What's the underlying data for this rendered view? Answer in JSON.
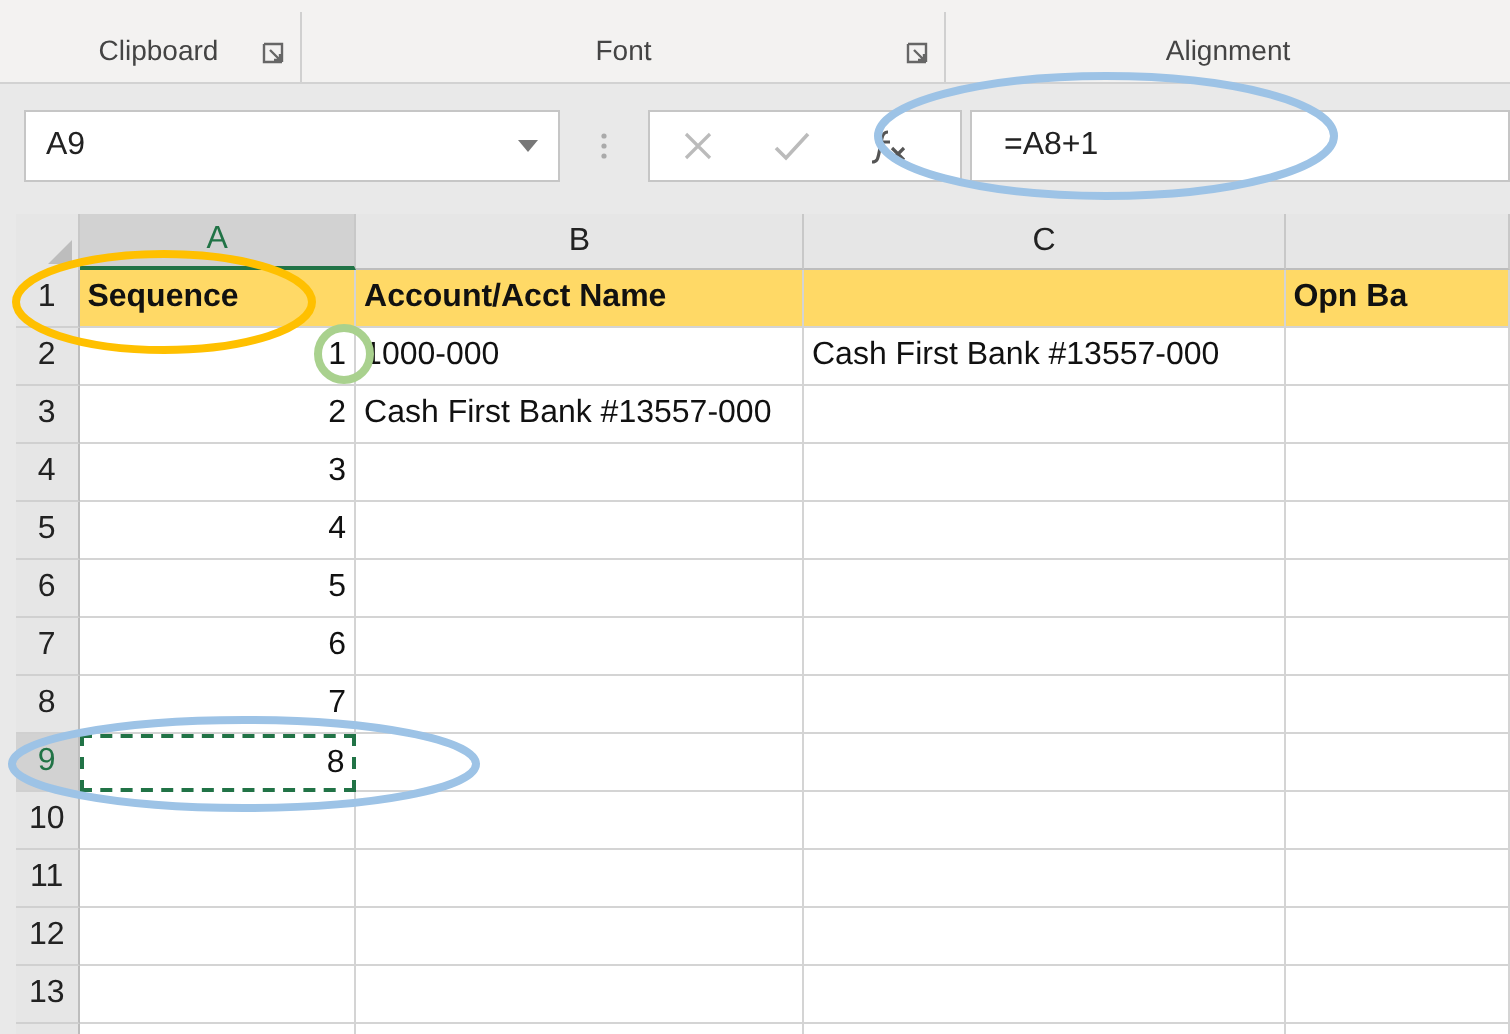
{
  "ribbon_groups": [
    {
      "label": "Clipboard",
      "launcher": true
    },
    {
      "label": "Font",
      "launcher": true
    },
    {
      "label": "Alignment",
      "launcher": false
    }
  ],
  "name_box": "A9",
  "formula": "=A8+1",
  "columns": [
    {
      "label": "A",
      "selected": true
    },
    {
      "label": "B",
      "selected": false
    },
    {
      "label": "C",
      "selected": false
    },
    {
      "selected": false
    }
  ],
  "rows": [
    {
      "num": "1",
      "kind": "header",
      "selected": false,
      "cells": {
        "A": "Sequence",
        "B": "Account/Acct Name",
        "D": "Opn Ba"
      }
    },
    {
      "num": "2",
      "kind": "data",
      "selected": false,
      "cells": {
        "A": "1",
        "B": "1000-000",
        "C": "Cash First Bank #13557-000"
      }
    },
    {
      "num": "3",
      "kind": "data",
      "selected": false,
      "cells": {
        "A": "2",
        "B": "Cash First Bank #13557-000"
      }
    },
    {
      "num": "4",
      "kind": "data",
      "selected": false,
      "cells": {
        "A": "3"
      }
    },
    {
      "num": "5",
      "kind": "data",
      "selected": false,
      "cells": {
        "A": "4"
      }
    },
    {
      "num": "6",
      "kind": "data",
      "selected": false,
      "cells": {
        "A": "5"
      }
    },
    {
      "num": "7",
      "kind": "data",
      "selected": false,
      "cells": {
        "A": "6"
      }
    },
    {
      "num": "8",
      "kind": "data",
      "selected": false,
      "cells": {
        "A": "7"
      }
    },
    {
      "num": "9",
      "kind": "data",
      "selected": true,
      "cells": {
        "A": "8"
      }
    },
    {
      "num": "10",
      "kind": "data",
      "selected": false,
      "cells": {}
    },
    {
      "num": "11",
      "kind": "data",
      "selected": false,
      "cells": {}
    },
    {
      "num": "12",
      "kind": "data",
      "selected": false,
      "cells": {}
    },
    {
      "num": "13",
      "kind": "data",
      "selected": false,
      "cells": {}
    }
  ],
  "annotations": [
    {
      "color": "#ffc000"
    },
    {
      "color": "#a9d18e"
    },
    {
      "color": "#9dc3e6"
    },
    {
      "color": "#9dc3e6"
    }
  ]
}
